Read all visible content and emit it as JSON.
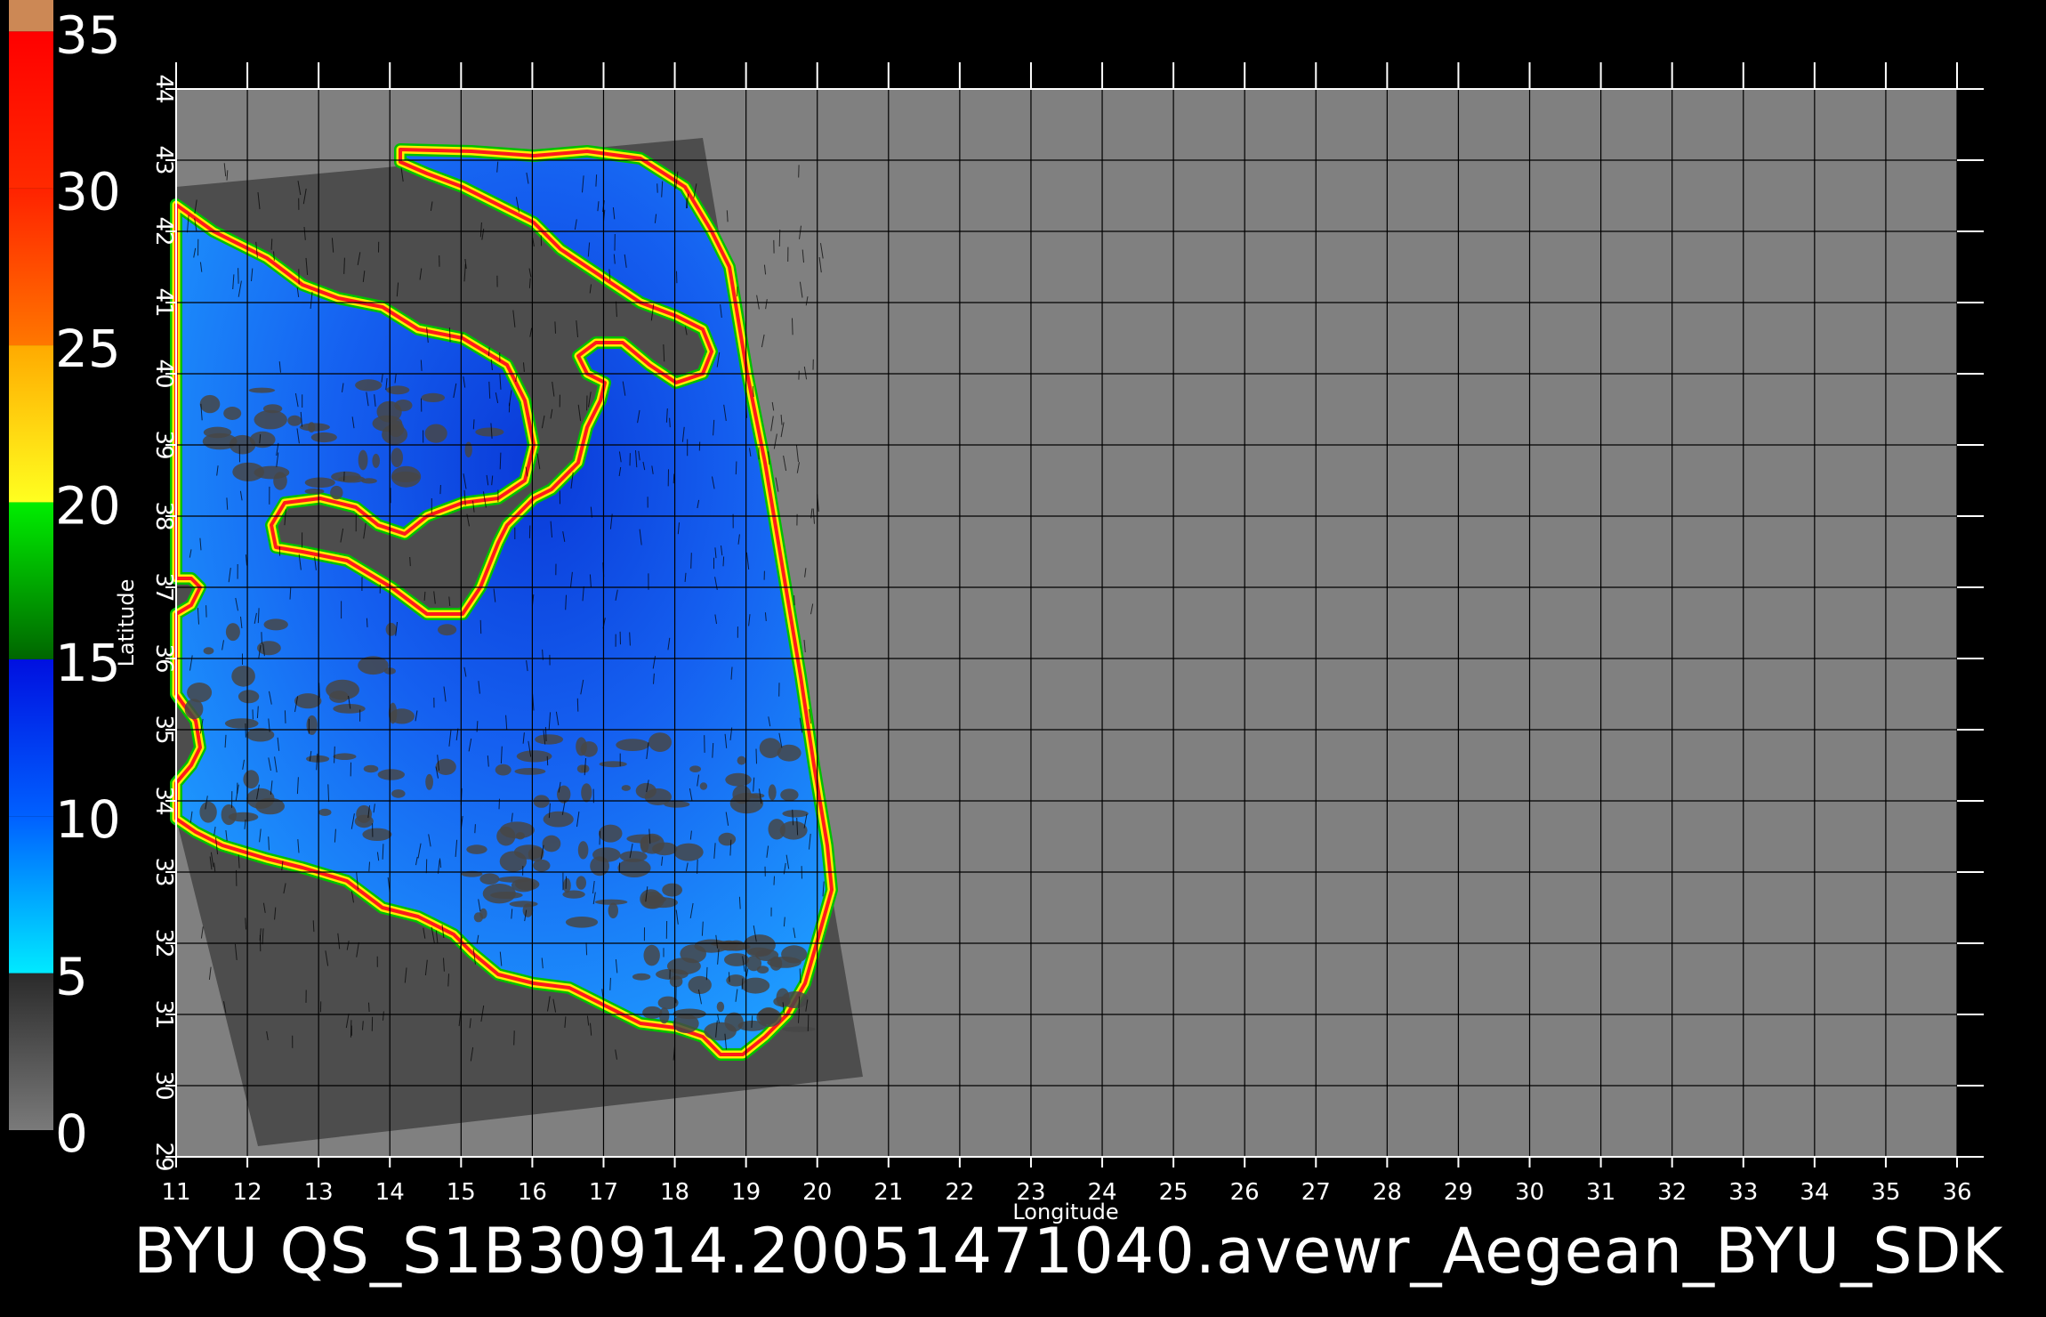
{
  "figure": {
    "caption": "BYU  QS_S1B30914.20051471040.avewr_Aegean_BYU_SDK",
    "xlabel": "Longitude",
    "ylabel": "Latitude",
    "x_ticks": [
      "11",
      "12",
      "13",
      "14",
      "15",
      "16",
      "17",
      "18",
      "19",
      "20",
      "21",
      "22",
      "23",
      "24",
      "25",
      "26",
      "27",
      "28",
      "29",
      "30",
      "31",
      "32",
      "33",
      "34",
      "35",
      "36"
    ],
    "y_ticks": [
      "29",
      "30",
      "31",
      "32",
      "33",
      "34",
      "35",
      "36",
      "37",
      "38",
      "39",
      "40",
      "41",
      "42",
      "43",
      "44"
    ],
    "colorbar": {
      "tick_labels": [
        "0",
        "5",
        "10",
        "15",
        "20",
        "25",
        "30",
        "35"
      ],
      "segments": [
        {
          "from": 0,
          "to": 5,
          "color_top": "#2a2a2a",
          "color_bottom": "#7a7a7a"
        },
        {
          "from": 5,
          "to": 10,
          "color_top": "#0060ff",
          "color_bottom": "#00eaff"
        },
        {
          "from": 10,
          "to": 15,
          "color_top": "#0010e0",
          "color_bottom": "#0060ff"
        },
        {
          "from": 15,
          "to": 20,
          "color_top": "#00ee00",
          "color_bottom": "#006600"
        },
        {
          "from": 20,
          "to": 25,
          "color_top": "#ffaa00",
          "color_bottom": "#ffff20"
        },
        {
          "from": 25,
          "to": 30,
          "color_top": "#ff2200",
          "color_bottom": "#ff7700"
        },
        {
          "from": 30,
          "to": 35,
          "color_top": "#ff0000",
          "color_bottom": "#ff2a00"
        },
        {
          "from": 35,
          "to": 36,
          "color_top": "#cc8855",
          "color_bottom": "#cc8855"
        }
      ]
    },
    "colors": {
      "map_background": "#808080",
      "swath": "#4d4d4d",
      "ocean": "#1e9bff",
      "ocean_deep": "#0a3ad8",
      "coast_rim_red": "#ff1a1a",
      "coast_rim_yellow": "#ffee00",
      "coast_rim_green": "#00c000",
      "land": "#474747",
      "grid": "#000000",
      "wind_vectors": "#000000"
    }
  }
}
